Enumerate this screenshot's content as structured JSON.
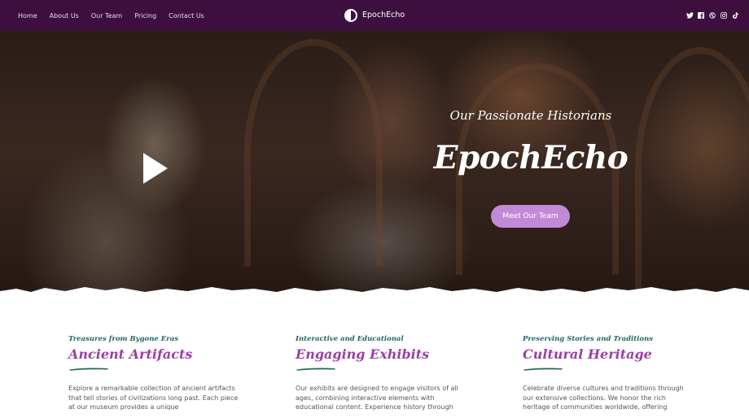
{
  "nav": {
    "links": [
      "Home",
      "About Us",
      "Our Team",
      "Pricing",
      "Contact Us"
    ],
    "brand": "EpochEcho",
    "brand_icon": "half-circle-logo-icon",
    "social_icons": [
      "twitter-icon",
      "facebook-icon",
      "dribbble-icon",
      "instagram-icon",
      "tiktok-icon"
    ],
    "background": "#3d0f3f"
  },
  "hero": {
    "subtitle": "Our Passionate Historians",
    "title": "EpochEcho",
    "cta_label": "Meet Our Team",
    "play_icon": "play-icon",
    "accent": "#c28ad6"
  },
  "features": [
    {
      "kicker": "Treasures from Bygone Eras",
      "title": "Ancient Artifacts",
      "body": "Explore a remarkable collection of ancient artifacts that tell stories of civilizations long past. Each piece at our museum provides a unique"
    },
    {
      "kicker": "Interactive and Educational",
      "title": "Engaging Exhibits",
      "body": "Our exhibits are designed to engage visitors of all ages, combining interactive elements with educational content. Experience history through"
    },
    {
      "kicker": "Preserving Stories and Traditions",
      "title": "Cultural Heritage",
      "body": "Celebrate diverse cultures and traditions through our extensive collections. We honor the rich heritage of communities worldwide, offering"
    }
  ],
  "colors": {
    "kicker": "#24645c",
    "title": "#9a3fa6",
    "stroke": "#24645c"
  }
}
